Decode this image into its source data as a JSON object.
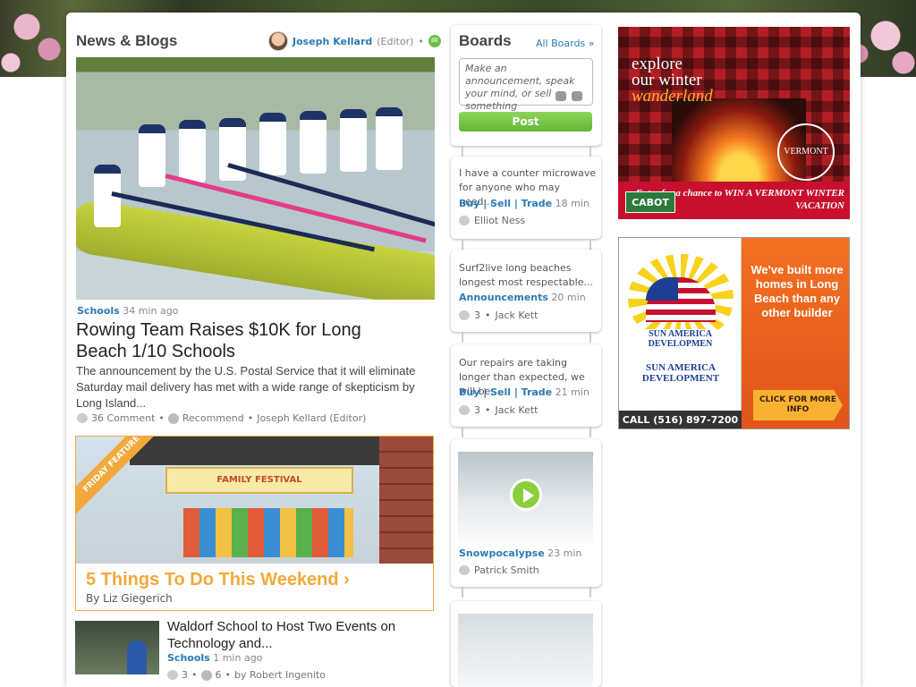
{
  "news": {
    "section_title": "News & Blogs",
    "author": {
      "name": "Joseph Kellard",
      "role": "(Editor)",
      "separator": "•"
    },
    "top_story": {
      "category": "Schools",
      "time": "34 min ago",
      "title": "Rowing Team Raises $10K for Long Beach 1/10 Schools",
      "body": "The announcement by the U.S. Postal Service that it will eliminate Saturday mail delivery has met with a wide range of skepticism by Long Island...",
      "comments": "36 Comment",
      "recommend": "Recommend",
      "byline": "Joseph Kellard (Editor)",
      "separator": "•"
    },
    "feature": {
      "ribbon": "FRIDAY FEATURE",
      "banner": "FAMILY FESTIVAL",
      "title": "5 Things To Do This Weekend ›",
      "author": "By Liz Giegerich"
    },
    "second_story": {
      "title": "Waldorf School to Host Two Events on Technology and...",
      "category": "Schools",
      "time": "1 min ago",
      "comments": "3",
      "recommends": "6",
      "byline": "by Robert Ingenito",
      "separator": "•"
    }
  },
  "boards": {
    "title": "Boards",
    "all_link": "All Boards »",
    "composer_placeholder": "Make an announcement, speak your mind, or sell something",
    "post_button": "Post",
    "items": [
      {
        "text": "I have a counter microwave for anyone who may need...",
        "category": "Buy | Sell | Trade",
        "time": "18 min",
        "user": "Elliot Ness",
        "comments": ""
      },
      {
        "text": "Surf2live long beaches longest most respectable...",
        "category": "Announcements",
        "time": "20 min",
        "user": "Jack Kett",
        "comments": "3"
      },
      {
        "text": "Our repairs are taking longer than expected, we will be...",
        "category": "Buy | Sell | Trade",
        "time": "21 min",
        "user": "Jack Kett",
        "comments": "3"
      },
      {
        "text": "",
        "category": "Snowpocalypse",
        "time": "23 min",
        "user": "Patrick Smith",
        "comments": ""
      }
    ],
    "separator": "•"
  },
  "ads": {
    "vermont": {
      "line1": "explore",
      "line2": "our winter",
      "line3": "wanderland",
      "seal": "VERMONT",
      "brand": "CABOT",
      "promo": "Enter for a chance to WIN A VERMONT WINTER VACATION"
    },
    "sun_america": {
      "name_banner": "SUN AMERICA DEVELOPMEN",
      "name_logo": "SUN AMERICA DEVELOPMENT",
      "tagline": "We've built more homes in Long Beach than any other builder",
      "cta": "CLICK FOR MORE INFO",
      "phone": "CALL (516) 897-7200"
    }
  },
  "colors": {
    "link": "#2a7ab8",
    "accent_green": "#6cc04a",
    "feature_orange": "#f2a93b"
  }
}
